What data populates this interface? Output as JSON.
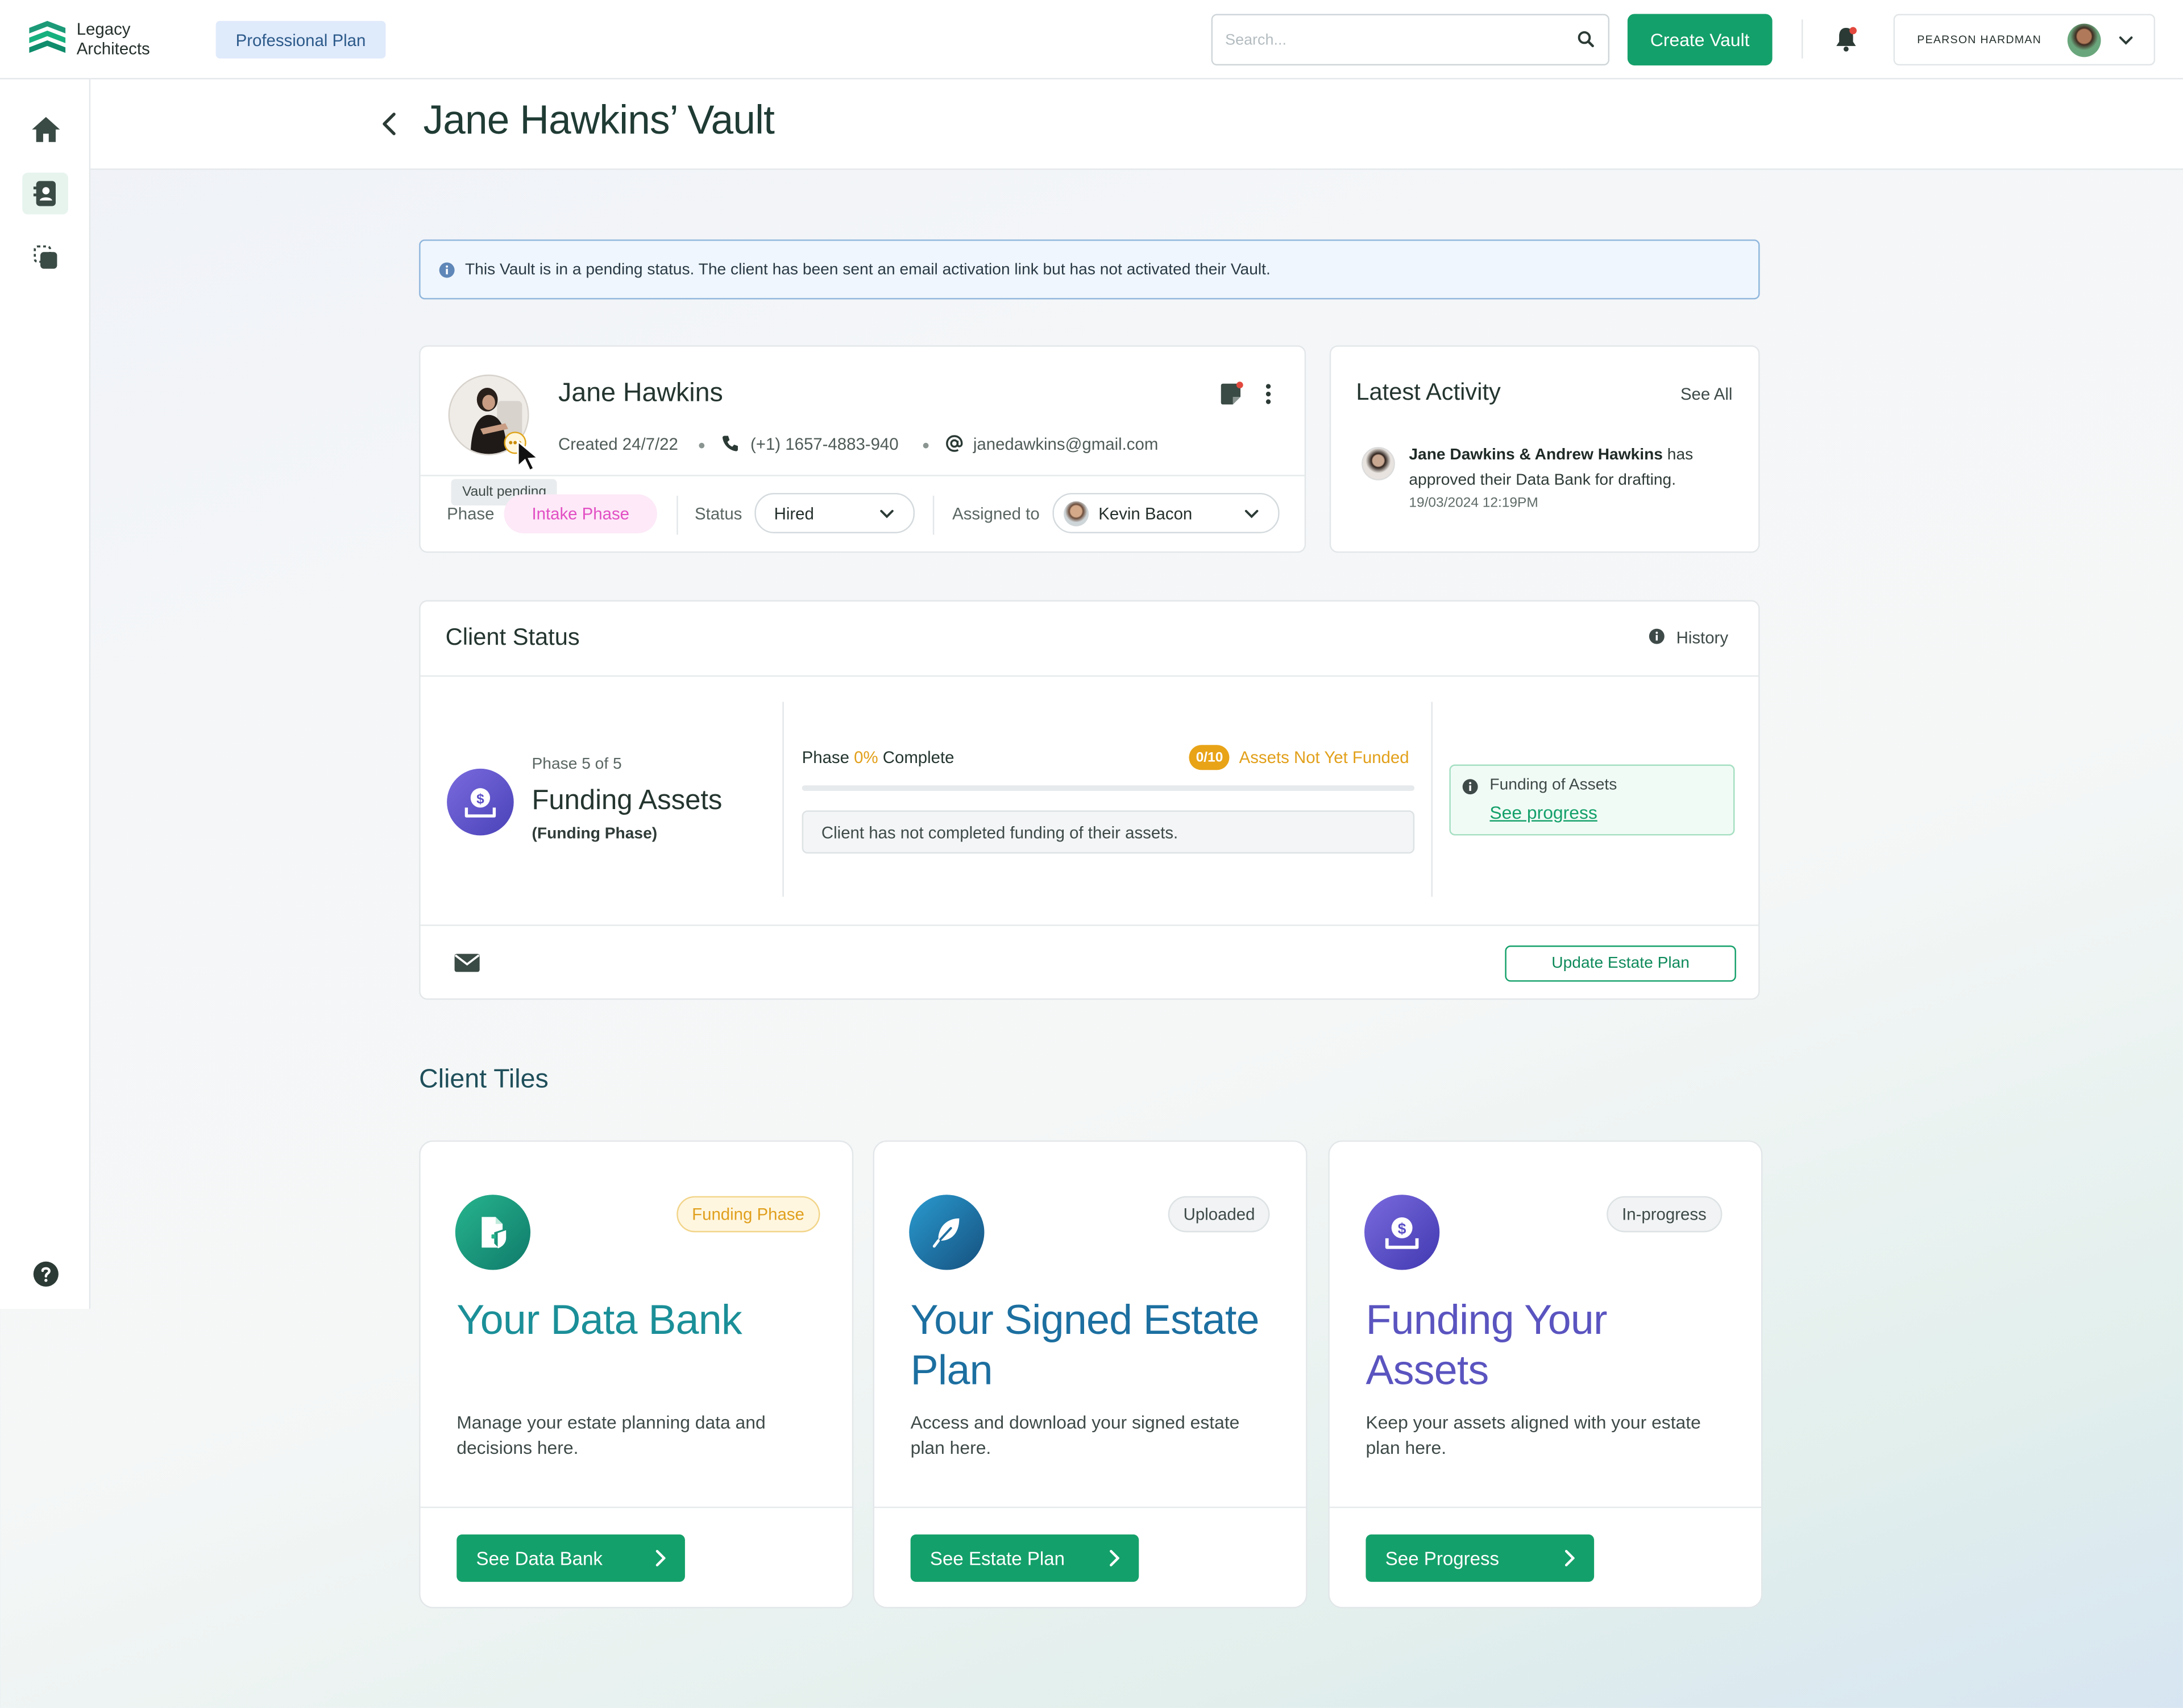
{
  "header": {
    "brand_line1": "Legacy",
    "brand_line2": "Architects",
    "plan": "Professional Plan",
    "search_placeholder": "Search...",
    "create_vault": "Create Vault",
    "user_name": "PEARSON HARDMAN",
    "icons": [
      "logo-icon",
      "search-icon",
      "bell-icon",
      "chevron-down-icon"
    ]
  },
  "sidebar": {
    "items": [
      {
        "icon": "home-icon"
      },
      {
        "icon": "contacts-icon",
        "active": true
      },
      {
        "icon": "copy-icon"
      },
      {
        "icon": "help-icon"
      }
    ]
  },
  "page": {
    "title": "Jane Hawkins’ Vault"
  },
  "banner": {
    "text": "This Vault is in a pending status. The client has been sent an email activation link but has not activated their Vault."
  },
  "client": {
    "name": "Jane Hawkins",
    "created": "Created 24/7/22",
    "phone": "(+1) 1657-4883-940",
    "email": "janedawkins@gmail.com",
    "tooltip": "Vault pending",
    "phase_label": "Phase",
    "phase_value": "Intake Phase",
    "status_label": "Status",
    "status_value": "Hired",
    "assigned_label": "Assigned to",
    "assigned_value": "Kevin Bacon"
  },
  "activity": {
    "title": "Latest Activity",
    "see_all": "See All",
    "names": "Jane Dawkins & Andrew Hawkins",
    "text": " has approved their Data Bank for drafting.",
    "time": "19/03/2024 12:19PM"
  },
  "client_status": {
    "title": "Client Status",
    "history": "History",
    "phase_count": "Phase 5 of 5",
    "phase_title": "Funding Assets",
    "phase_sub": "(Funding Phase)",
    "progress_pre": "Phase ",
    "progress_pct": "0%",
    "progress_post": " Complete",
    "progress_fraction": 0,
    "count_badge": "0/10",
    "not_funded": "Assets Not Yet Funded",
    "note": "Client has not completed funding of their assets.",
    "mini_title": "Funding of Assets",
    "mini_link": "See progress",
    "update_button": "Update Estate Plan",
    "colors": {
      "accent": "#14a06a",
      "warning": "#e2a01a"
    }
  },
  "tiles": {
    "section_title": "Client Tiles",
    "items": [
      {
        "badge": "Funding Phase",
        "title": "Your Data Bank",
        "desc": "Manage your estate planning data and decisions here.",
        "button": "See Data Bank",
        "icon": "document-shield-icon",
        "color": "#1b8f98"
      },
      {
        "badge": "Uploaded",
        "title": "Your Signed Estate Plan",
        "desc": "Access and download your signed estate plan here.",
        "button": "See Estate Plan",
        "icon": "feather-icon",
        "color": "#1c6fa0"
      },
      {
        "badge": "In-progress",
        "title": "Funding Your Assets",
        "desc": "Keep your assets aligned with your estate plan here.",
        "button": "See Progress",
        "icon": "funding-icon",
        "color": "#5a54c0"
      }
    ]
  }
}
